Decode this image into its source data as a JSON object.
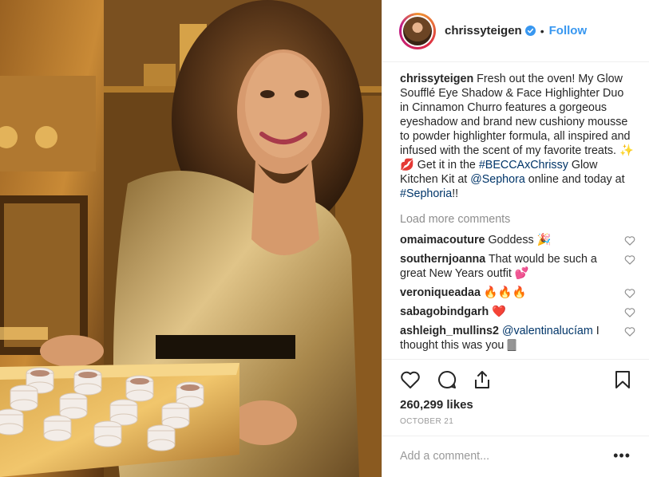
{
  "post": {
    "username": "chrissyteigen",
    "follow_label": "Follow",
    "separator": "•",
    "caption": {
      "user": "chrissyteigen",
      "text_1": " Fresh out the oven! My Glow Soufflé Eye Shadow & Face Highlighter Duo in Cinnamon Churro features a gorgeous eyeshadow and brand new cushiony mousse to powder highlighter formula, all inspired and infused with the scent of my favorite treats. ✨💋 Get it in the ",
      "hashtag_1": "#BECCAxChrissy",
      "text_2": " Glow Kitchen Kit at ",
      "mention_1": "@Sephora",
      "text_3": " online and today at ",
      "hashtag_2": "#Sephoria",
      "text_4": "!!"
    },
    "load_more": "Load more comments",
    "comments": [
      {
        "user": "omaimacouture",
        "text": " Goddess 🎉"
      },
      {
        "user": "southernjoanna",
        "text": " That would be such a great New Years outfit 💕"
      },
      {
        "user": "veroniqueadaa",
        "text": " 🔥🔥🔥"
      },
      {
        "user": "sabagobindgarh",
        "text": " ❤️"
      },
      {
        "user": "ashleigh_mullins2",
        "mention": "@valentinalucíam",
        "text": " I thought this was you 🀫"
      }
    ],
    "likes": "260,299 likes",
    "date": "OCTOBER 21",
    "add_comment_placeholder": "Add a comment...",
    "more_options": "•••"
  },
  "colors": {
    "link": "#003569",
    "follow": "#3897f0",
    "muted": "#8e8e8e"
  }
}
